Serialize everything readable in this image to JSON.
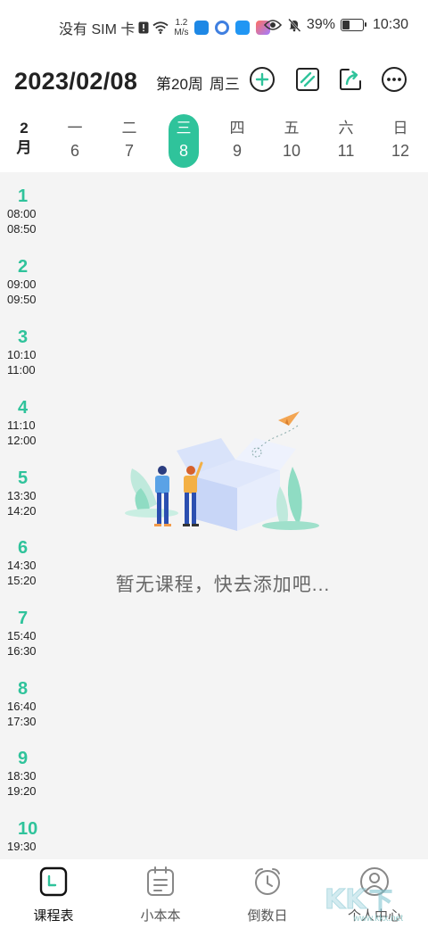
{
  "status_bar": {
    "carrier": "没有 SIM 卡",
    "net_speed_value": "1.2",
    "net_speed_unit": "M/s",
    "battery": "39%",
    "battery_level": 0.39,
    "time": "10:30"
  },
  "header": {
    "date": "2023/02/08",
    "week": "第20周",
    "weekday": "周三"
  },
  "week": {
    "month_number": "2",
    "month_char": "月",
    "days": [
      {
        "dow": "一",
        "num": "6"
      },
      {
        "dow": "二",
        "num": "7"
      },
      {
        "dow": "三",
        "num": "8",
        "active": true
      },
      {
        "dow": "四",
        "num": "9"
      },
      {
        "dow": "五",
        "num": "10"
      },
      {
        "dow": "六",
        "num": "11"
      },
      {
        "dow": "日",
        "num": "12"
      }
    ]
  },
  "periods": [
    {
      "num": "1",
      "start": "08:00",
      "end": "08:50"
    },
    {
      "num": "2",
      "start": "09:00",
      "end": "09:50"
    },
    {
      "num": "3",
      "start": "10:10",
      "end": "11:00"
    },
    {
      "num": "4",
      "start": "11:10",
      "end": "12:00"
    },
    {
      "num": "5",
      "start": "13:30",
      "end": "14:20"
    },
    {
      "num": "6",
      "start": "14:30",
      "end": "15:20"
    },
    {
      "num": "7",
      "start": "15:40",
      "end": "16:30"
    },
    {
      "num": "8",
      "start": "16:40",
      "end": "17:30"
    },
    {
      "num": "9",
      "start": "18:30",
      "end": "19:20"
    },
    {
      "num": "10",
      "start": "19:30",
      "end": ""
    }
  ],
  "empty_message": "暂无课程，快去添加吧...",
  "nav": [
    {
      "label": "课程表",
      "icon": "schedule-icon",
      "active": true
    },
    {
      "label": "小本本",
      "icon": "notebook-icon"
    },
    {
      "label": "倒数日",
      "icon": "alarm-clock-icon"
    },
    {
      "label": "个人中心",
      "icon": "profile-icon"
    }
  ],
  "watermark": {
    "text": "KK下载",
    "url": "www.kkx.net"
  },
  "colors": {
    "accent": "#2fc39b",
    "background": "#f4f4f4"
  }
}
